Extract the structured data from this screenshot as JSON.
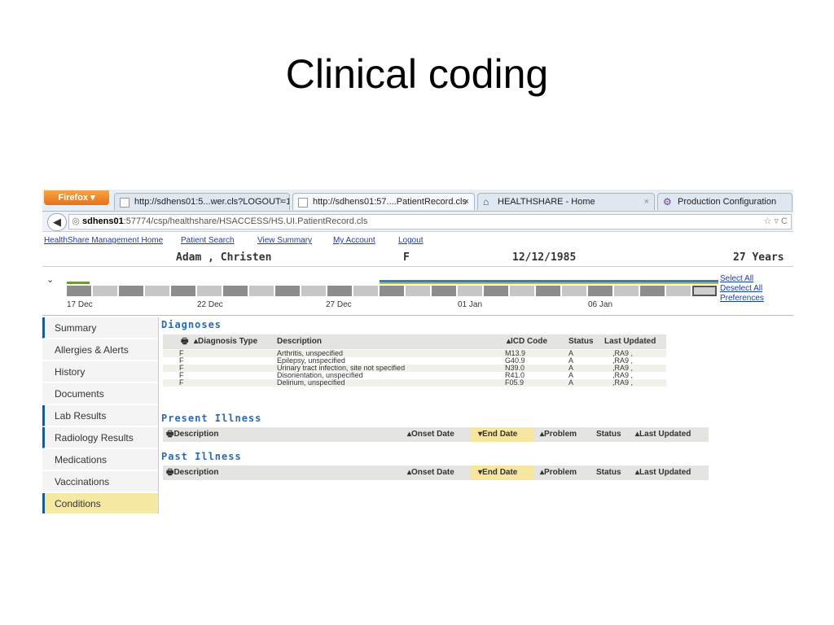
{
  "slide": {
    "title": "Clinical coding"
  },
  "browser": {
    "menu_button": "Firefox",
    "tabs": [
      {
        "label": "http://sdhens01:5...wer.cls?LOGOUT=1"
      },
      {
        "label": "http://sdhens01:57....PatientRecord.cls"
      },
      {
        "label": "HEALTHSHARE - Home"
      },
      {
        "label": "Production Configuration"
      }
    ],
    "url_host": "sdhens01",
    "url_rest": ":57774/csp/healthshare/HSACCESS/HS.UI.PatientRecord.cls"
  },
  "top_links": [
    "HealthShare Management Home",
    "Patient Search",
    "View Summary",
    "My Account",
    "Logout"
  ],
  "patient": {
    "name": "Adam , Christen",
    "sex": "F",
    "dob": "12/12/1985",
    "age": "27 Years"
  },
  "timeline": {
    "labels": [
      "17 Dec",
      "22 Dec",
      "27 Dec",
      "01 Jan",
      "06 Jan"
    ],
    "links": [
      "Select All",
      "Deselect All",
      "Preferences"
    ]
  },
  "sidebar": {
    "items": [
      {
        "label": "Summary"
      },
      {
        "label": "Allergies & Alerts"
      },
      {
        "label": "History"
      },
      {
        "label": "Documents"
      },
      {
        "label": "Lab Results"
      },
      {
        "label": "Radiology Results"
      },
      {
        "label": "Medications"
      },
      {
        "label": "Vaccinations"
      },
      {
        "label": "Conditions"
      }
    ]
  },
  "diagnoses": {
    "title": "Diagnoses",
    "headers": {
      "type": "Diagnosis Type",
      "description": "Description",
      "icd": "ICD Code",
      "status": "Status",
      "updated": "Last Updated"
    },
    "rows": [
      {
        "type": "F",
        "description": "Arthritis, unspecified",
        "icd": "M13.9",
        "status": "A",
        "updated": ",RA9 ,"
      },
      {
        "type": "F",
        "description": "Epilepsy, unspecified",
        "icd": "G40.9",
        "status": "A",
        "updated": ",RA9 ,"
      },
      {
        "type": "F",
        "description": "Urinary tract infection, site not specified",
        "icd": "N39.0",
        "status": "A",
        "updated": ",RA9 ,"
      },
      {
        "type": "F",
        "description": "Disorientation, unspecified",
        "icd": "R41.0",
        "status": "A",
        "updated": ",RA9 ,"
      },
      {
        "type": "F",
        "description": "Delirium, unspecified",
        "icd": "F05.9",
        "status": "A",
        "updated": ",RA9 ,"
      }
    ]
  },
  "present_illness": {
    "title": "Present Illness",
    "headers": {
      "description": "Description",
      "onset": "Onset Date",
      "end": "End Date",
      "problem": "Problem",
      "status": "Status",
      "updated": "Last Updated"
    }
  },
  "past_illness": {
    "title": "Past Illness",
    "headers": {
      "description": "Description",
      "onset": "Onset Date",
      "end": "End Date",
      "problem": "Problem",
      "status": "Status",
      "updated": "Last Updated"
    }
  },
  "colors": {
    "link": "#1a3ea8",
    "section_title": "#2a6bb3",
    "active_nav": "#f5e9a3",
    "accent_bar": "#1e5a8c",
    "firefox": "#e6711a"
  }
}
